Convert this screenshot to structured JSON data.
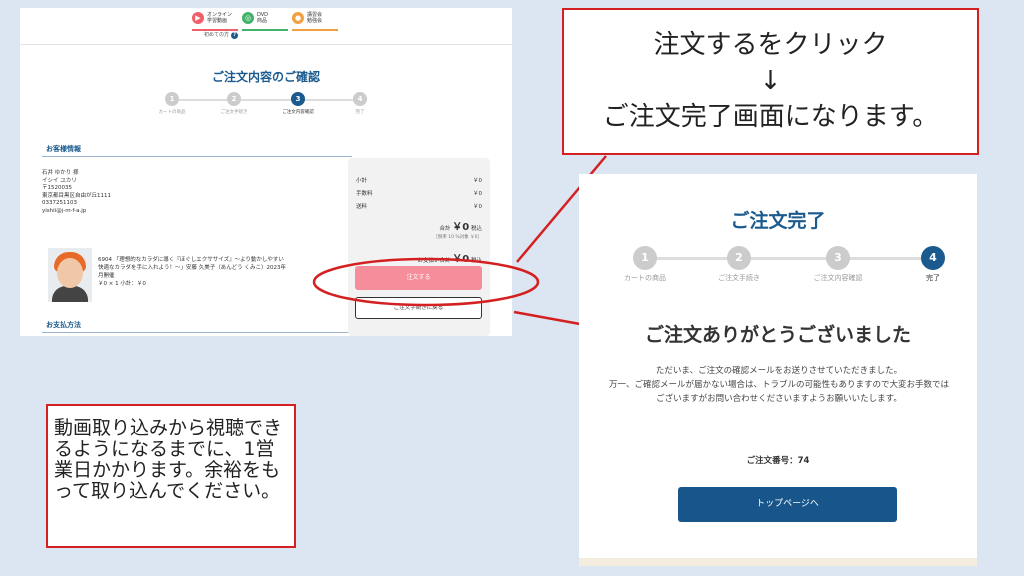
{
  "confirm_page": {
    "nav": [
      {
        "label": "オンライン\n学習動画",
        "icon": "play-icon",
        "color": "#f0606a"
      },
      {
        "label": "DVD\n商品",
        "icon": "dvd-icon",
        "color": "#42b36a"
      },
      {
        "label": "講習会\n勉強会",
        "icon": "seminar-icon",
        "color": "#f0a040"
      }
    ],
    "beginner_label": "初めての方",
    "beginner_badge": "?",
    "title": "ご注文内容のご確認",
    "steps": [
      {
        "num": "1",
        "label": "カートの商品"
      },
      {
        "num": "2",
        "label": "ご注文手続き"
      },
      {
        "num": "3",
        "label": "ご注文内容確認"
      },
      {
        "num": "4",
        "label": "完了"
      }
    ],
    "active_step": 3,
    "customer_heading": "お客様情報",
    "customer_lines": [
      "石井 ゆかり 様",
      "イシイ ユカリ",
      "〒1520035",
      "東京都目黒区自由が丘1111",
      "0337251103",
      "yishii@j-m-f-a.jp"
    ],
    "product_lines": [
      "6904 「理想的なカラダに導く『ほぐしエクササイズ』～より動かしやすい",
      "快適なカラダを手に入れよう！～」安藤 久美子（あんどう くみこ）2023年",
      "月開催",
      "￥0 × 1 小計：￥0"
    ],
    "payment_heading": "お支払方法",
    "summary": {
      "subtotal_label": "小計",
      "subtotal": "￥0",
      "fee_label": "手数料",
      "fee": "￥0",
      "shipping_label": "送料",
      "shipping": "￥0",
      "total_label": "合計",
      "total": "￥0",
      "total_suffix": "税込",
      "tax_note": "［税率 10 %対象 ￥0］",
      "payment_total_label": "お支払い合計",
      "payment_total": "￥0",
      "payment_total_suffix": "税込"
    },
    "order_button": "注文する",
    "back_button": "ご注文手続きに戻る"
  },
  "callout_top": [
    "注文するをクリック",
    "↓",
    "ご注文完了画面になります。"
  ],
  "callout_bottom": "動画取り込みから視聴できるようになるまでに、1営業日かかります。余裕をもって取り込んでください。",
  "complete_page": {
    "title": "ご注文完了",
    "steps": [
      {
        "num": "1",
        "label": "カートの商品"
      },
      {
        "num": "2",
        "label": "ご注文手続き"
      },
      {
        "num": "3",
        "label": "ご注文内容確認"
      },
      {
        "num": "4",
        "label": "完了"
      }
    ],
    "active_step": 4,
    "thanks": "ご注文ありがとうございました",
    "desc_lines": [
      "ただいま、ご注文の確認メールをお送りさせていただきました。",
      "万一、ご確認メールが届かない場合は、トラブルの可能性もありますので大変お手数ではございますがお問い合わせくださいますようお願いいたします。"
    ],
    "order_label": "ご注文番号：",
    "order_number": "74",
    "top_button": "トップページへ"
  },
  "colors": {
    "accent": "#1a5a8e",
    "callout_border": "#d42020",
    "order_button": "#f58e9a",
    "active_step": "#1a5a8e"
  }
}
